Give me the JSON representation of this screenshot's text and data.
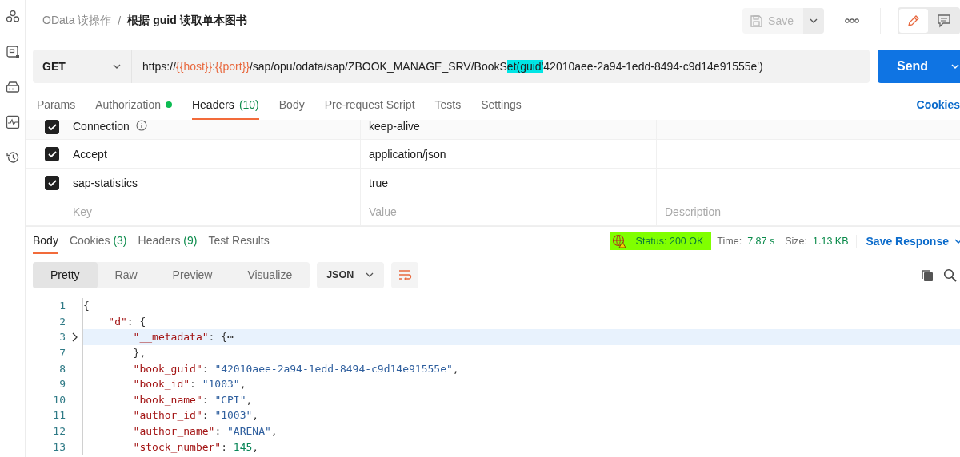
{
  "sidebar": {
    "items": [
      {
        "kind": "collections"
      },
      {
        "kind": "apis"
      },
      {
        "kind": "environments"
      },
      {
        "kind": "monitors"
      },
      {
        "kind": "history"
      }
    ]
  },
  "header": {
    "breadcrumb": [
      {
        "text": "OData 读操作",
        "current": false
      },
      {
        "text": "根据 guid 读取单本图书",
        "current": true
      }
    ],
    "separator": "/",
    "save": {
      "label": "Save",
      "disabled": true
    },
    "mode_buttons": [
      {
        "kind": "edit",
        "selected": true
      },
      {
        "kind": "comments",
        "selected": false
      }
    ]
  },
  "request": {
    "method": "GET",
    "url": [
      {
        "kind": "plain",
        "text": "https://"
      },
      {
        "kind": "variable",
        "text": "{{host}}"
      },
      {
        "kind": "plain",
        "text": ":"
      },
      {
        "kind": "variable",
        "text": "{{port}}"
      },
      {
        "kind": "plain",
        "text": "/sap/opu/odata/sap/ZBOOK_MANAGE_SRV/BookS"
      },
      {
        "kind": "highlight",
        "text": "et(guid'"
      },
      {
        "kind": "plain",
        "text": "42010aee-2a94-1edd-8494-c9d14e91555e')"
      }
    ],
    "send": "Send"
  },
  "request_tabs": [
    {
      "label": "Params",
      "selected": false
    },
    {
      "label": "Authorization",
      "selected": false,
      "dot": true
    },
    {
      "label": "Headers",
      "count": "(10)",
      "selected": true
    },
    {
      "label": "Body",
      "selected": false
    },
    {
      "label": "Pre-request Script",
      "selected": false
    },
    {
      "label": "Tests",
      "selected": false
    },
    {
      "label": "Settings",
      "selected": false
    }
  ],
  "cookies_link": "Cookies",
  "headers_table": {
    "rows": [
      {
        "checked": true,
        "key": "Connection",
        "info": true,
        "value": "keep-alive"
      },
      {
        "checked": true,
        "key": "Accept",
        "value": "application/json"
      },
      {
        "checked": true,
        "key": "sap-statistics",
        "value": "true"
      }
    ],
    "placeholders": {
      "key": "Key",
      "value": "Value",
      "description": "Description"
    }
  },
  "response_tabs": [
    {
      "label": "Body",
      "selected": true
    },
    {
      "label": "Cookies",
      "count": "(3)",
      "selected": false
    },
    {
      "label": "Headers",
      "count": "(9)",
      "selected": false
    },
    {
      "label": "Test Results",
      "selected": false
    }
  ],
  "response_meta": {
    "status_label": "Status:",
    "status": "200 OK",
    "status_highlighted": true,
    "time_label": "Time:",
    "time": "7.87 s",
    "size_label": "Size:",
    "size": "1.13 KB",
    "save_response": "Save Response"
  },
  "view_tabs": [
    {
      "label": "Pretty",
      "selected": true
    },
    {
      "label": "Raw",
      "selected": false
    },
    {
      "label": "Preview",
      "selected": false
    },
    {
      "label": "Visualize",
      "selected": false
    }
  ],
  "format": "JSON",
  "code": [
    {
      "number": "1",
      "selected": false,
      "tokens": [
        {
          "kind": "punct",
          "text": "{"
        }
      ]
    },
    {
      "number": "2",
      "selected": false,
      "tokens": [
        {
          "kind": "key",
          "text": "    \"d\""
        },
        {
          "kind": "punct",
          "text": ": {"
        }
      ]
    },
    {
      "number": "3",
      "folded": true,
      "selected": true,
      "tokens": [
        {
          "kind": "key",
          "text": "        \"__metadata\""
        },
        {
          "kind": "punct",
          "text": ": {⋯"
        }
      ]
    },
    {
      "number": "7",
      "selected": false,
      "tokens": [
        {
          "kind": "punct",
          "text": "        },"
        }
      ]
    },
    {
      "number": "8",
      "selected": false,
      "tokens": [
        {
          "kind": "key",
          "text": "        \"book_guid\""
        },
        {
          "kind": "punct",
          "text": ": "
        },
        {
          "kind": "str",
          "text": "\"42010aee-2a94-1edd-8494-c9d14e91555e\""
        },
        {
          "kind": "punct",
          "text": ","
        }
      ]
    },
    {
      "number": "9",
      "selected": false,
      "tokens": [
        {
          "kind": "key",
          "text": "        \"book_id\""
        },
        {
          "kind": "punct",
          "text": ": "
        },
        {
          "kind": "str",
          "text": "\"1003\""
        },
        {
          "kind": "punct",
          "text": ","
        }
      ]
    },
    {
      "number": "10",
      "selected": false,
      "tokens": [
        {
          "kind": "key",
          "text": "        \"book_name\""
        },
        {
          "kind": "punct",
          "text": ": "
        },
        {
          "kind": "str",
          "text": "\"CPI\""
        },
        {
          "kind": "punct",
          "text": ","
        }
      ]
    },
    {
      "number": "11",
      "selected": false,
      "tokens": [
        {
          "kind": "key",
          "text": "        \"author_id\""
        },
        {
          "kind": "punct",
          "text": ": "
        },
        {
          "kind": "str",
          "text": "\"1003\""
        },
        {
          "kind": "punct",
          "text": ","
        }
      ]
    },
    {
      "number": "12",
      "selected": false,
      "tokens": [
        {
          "kind": "key",
          "text": "        \"author_name\""
        },
        {
          "kind": "punct",
          "text": ": "
        },
        {
          "kind": "str",
          "text": "\"ARENA\""
        },
        {
          "kind": "punct",
          "text": ","
        }
      ]
    },
    {
      "number": "13",
      "selected": false,
      "tokens": [
        {
          "kind": "key",
          "text": "        \"stock_number\""
        },
        {
          "kind": "punct",
          "text": ": "
        },
        {
          "kind": "num",
          "text": "145"
        },
        {
          "kind": "punct",
          "text": ","
        }
      ]
    }
  ]
}
